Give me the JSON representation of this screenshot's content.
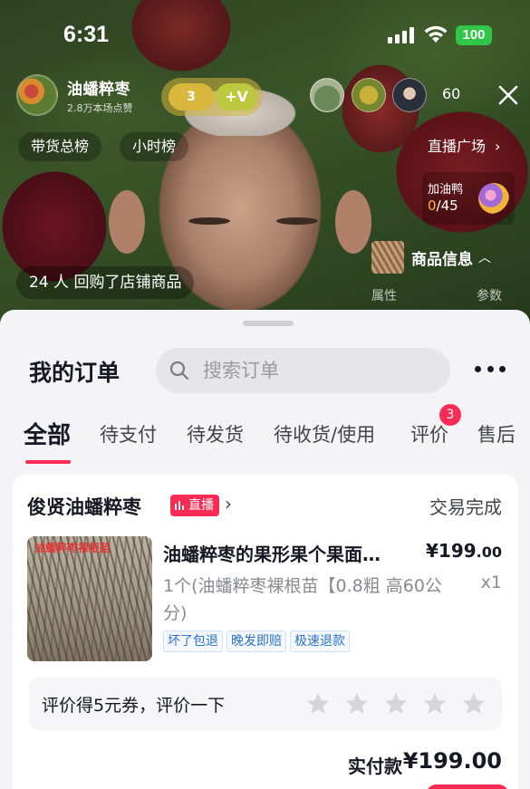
{
  "status_bar": {
    "time": "6:31",
    "battery": "100"
  },
  "live": {
    "host_name": "油蟠粹枣",
    "host_likes": "2.8万本场点赞",
    "fan_level": "3",
    "fan_plus": "+V",
    "viewer_count": "60",
    "pills": [
      "带货总榜",
      "小时榜"
    ],
    "square_link": "直播广场",
    "task": {
      "label": "加油鸭",
      "current": "0",
      "total": "/45"
    },
    "repurchase": "24 人 回购了店铺商品",
    "product_info": "商品信息",
    "attr_labels": [
      "属性",
      "参数"
    ]
  },
  "sheet": {
    "title": "我的订单",
    "search_placeholder": "搜索订单",
    "tabs": [
      "全部",
      "待支付",
      "待发货",
      "待收货/使用",
      "评价",
      "售后"
    ],
    "active_tab": "全部",
    "review_badge": "3"
  },
  "order": {
    "shop_name": "俊贤油蟠粹枣",
    "live_tag": "直播",
    "status": "交易完成",
    "image_caption": "油蟠粹枣裸根苗",
    "product_title": "油蟠粹枣的果形果个果面…",
    "price_main": "¥199",
    "price_cents": ".00",
    "spec": "1个(油蟠粹枣裸根苗【0.8粗 高60公分)",
    "quantity": "x1",
    "guarantees": [
      "坏了包退",
      "晚发即赔",
      "极速退款"
    ],
    "review_prompt": "评价得5元券，评价一下",
    "paid_label": "实付款",
    "paid_amount": "¥199.00"
  },
  "colors": {
    "accent": "#fe2c55",
    "tag_blue": "#2b72c9",
    "battery_green": "#31c54a"
  }
}
